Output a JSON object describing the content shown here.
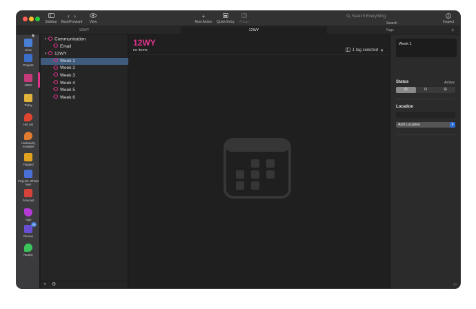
{
  "toolbar": {
    "sidebar_label": "Sidebar",
    "back_forward_label": "Back/Forward",
    "view_label": "View",
    "new_action_label": "New Action",
    "quick_entry_label": "Quick Entry",
    "focus_label": "Focus",
    "search_placeholder": "Search Everything",
    "search_label": "Search",
    "inspect_label": "Inspect"
  },
  "tabs": [
    {
      "label": "12WY"
    },
    {
      "label": "12WY"
    },
    {
      "label": "Tags"
    }
  ],
  "perspectives": [
    {
      "label": "Inbox",
      "badge": "5",
      "icon": "inbox-icon",
      "color": "#4a7fd6"
    },
    {
      "label": "Projects",
      "icon": "projects-icon",
      "color": "#3b6ec9"
    },
    {
      "label": "12WY",
      "icon": "calendar-icon",
      "color": "#c43a7a"
    },
    {
      "label": "Today",
      "icon": "today-icon",
      "color": "#e2b33a"
    },
    {
      "label": "Hot List",
      "icon": "flame-icon",
      "color": "#e0452f"
    },
    {
      "label": "Husbandry Available",
      "icon": "flame-icon",
      "color": "#e07a2f"
    },
    {
      "label": "Flagged",
      "icon": "flag-icon",
      "color": "#e0a21f"
    },
    {
      "label": "Projects: What's Next",
      "icon": "projects-icon",
      "color": "#4a6fd6"
    },
    {
      "label": "Forecast",
      "icon": "forecast-icon",
      "color": "#d6423a"
    },
    {
      "label": "Tags",
      "icon": "tag-icon",
      "color": "#b43ad6"
    },
    {
      "label": "Review",
      "badge": "46",
      "icon": "review-icon",
      "color": "#6a4fd6"
    },
    {
      "label": "Nearby",
      "icon": "location-pin-icon",
      "color": "#3ac45a"
    }
  ],
  "tags": [
    {
      "label": "Communication",
      "level": 0,
      "expanded": true
    },
    {
      "label": "Email",
      "level": 1
    },
    {
      "label": "12WY",
      "level": 0,
      "expanded": true
    },
    {
      "label": "Week 1",
      "level": 1,
      "selected": true
    },
    {
      "label": "Week 2",
      "level": 1
    },
    {
      "label": "Week 3",
      "level": 1
    },
    {
      "label": "Week 4",
      "level": 1
    },
    {
      "label": "Week 5",
      "level": 1
    },
    {
      "label": "Week 6",
      "level": 1
    }
  ],
  "main": {
    "title": "12WY",
    "count": "no items",
    "selection": "1 tag selected"
  },
  "inspector": {
    "note": "Week 1",
    "status_label": "Status",
    "status_value": "Active",
    "location_label": "Location",
    "location_select": "Add Location"
  },
  "colors": {
    "accent_pink": "#e2338c",
    "selection_blue": "#3f5b7d",
    "background": "#1f1f1f"
  }
}
